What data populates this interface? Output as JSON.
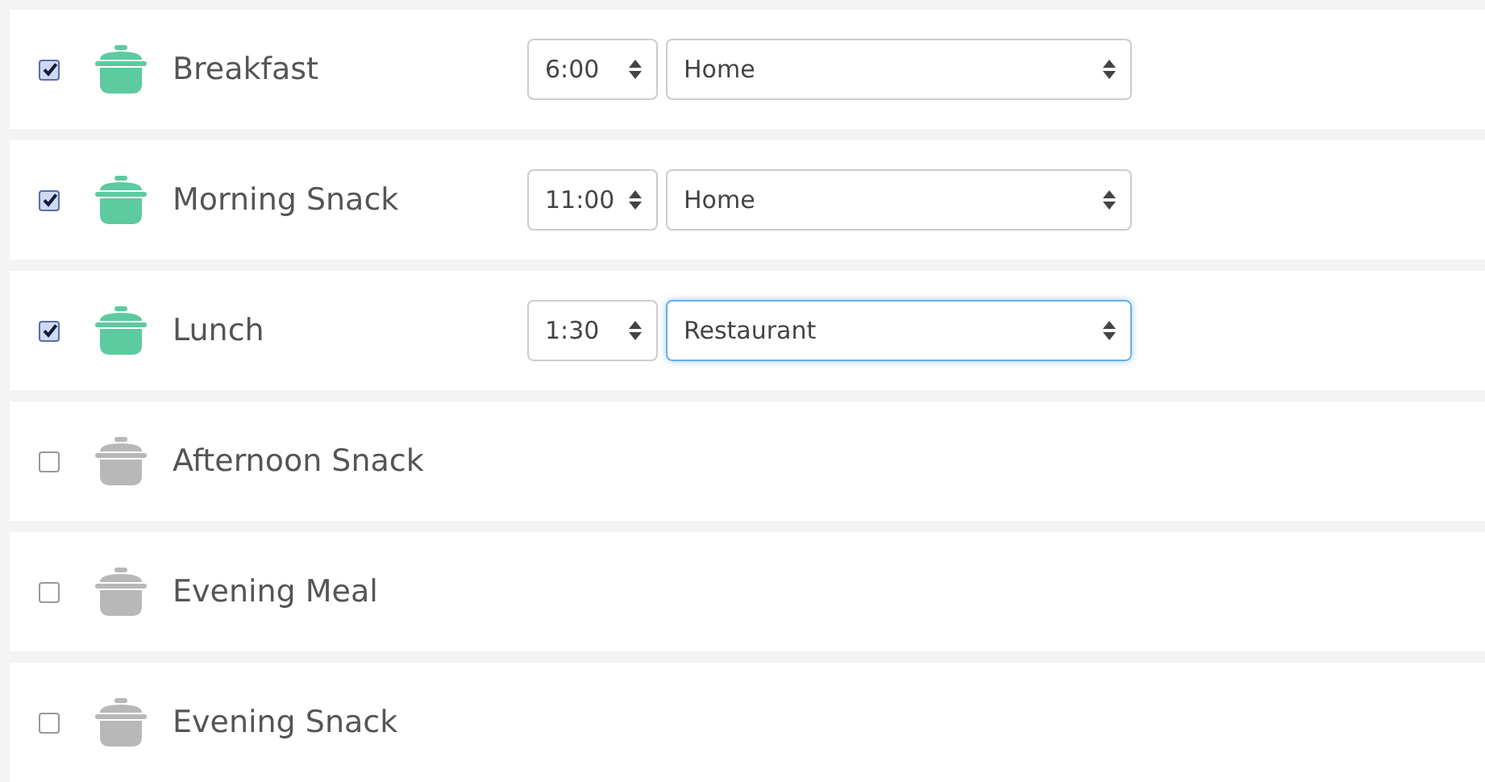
{
  "meals": [
    {
      "name": "Breakfast",
      "checked": true,
      "time": "6:00",
      "place": "Home",
      "place_focused": false
    },
    {
      "name": "Morning Snack",
      "checked": true,
      "time": "11:00",
      "place": "Home",
      "place_focused": false
    },
    {
      "name": "Lunch",
      "checked": true,
      "time": "1:30",
      "place": "Restaurant",
      "place_focused": true
    },
    {
      "name": "Afternoon Snack",
      "checked": false
    },
    {
      "name": "Evening Meal",
      "checked": false
    },
    {
      "name": "Evening Snack",
      "checked": false
    }
  ]
}
